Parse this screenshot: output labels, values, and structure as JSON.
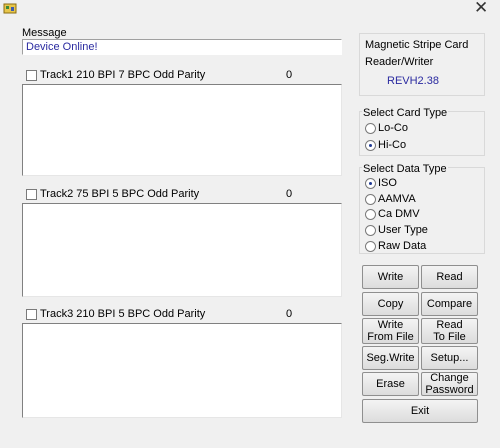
{
  "message": {
    "label": "Message",
    "value": "Device Online!"
  },
  "tracks": [
    {
      "label": "Track1  210 BPI  7 BPC  Odd Parity",
      "count": "0"
    },
    {
      "label": "Track2  75 BPI  5 BPC  Odd Parity",
      "count": "0"
    },
    {
      "label": "Track3  210 BPI  5 BPC  Odd Parity",
      "count": "0"
    }
  ],
  "device": {
    "line1": "Magnetic Stripe Card",
    "line2": "Reader/Writer",
    "version": "REVH2.38"
  },
  "card_type": {
    "title": "Select Card Type",
    "options": [
      "Lo-Co",
      "Hi-Co"
    ],
    "selected": "Hi-Co"
  },
  "data_type": {
    "title": "Select Data Type",
    "options": [
      "ISO",
      "AAMVA",
      "Ca DMV",
      "User Type",
      "Raw Data"
    ],
    "selected": "ISO"
  },
  "buttons": {
    "write": "Write",
    "read": "Read",
    "copy": "Copy",
    "compare": "Compare",
    "write_from_file": "Write\nFrom File",
    "read_to_file": "Read\nTo File",
    "seg_write": "Seg.Write",
    "setup": "Setup...",
    "erase": "Erase",
    "change_password": "Change\nPassword",
    "exit": "Exit"
  },
  "colors": {
    "version": "#2a2aa0",
    "message_text": "#2a2aa0",
    "radio_dot": "#1f3a93"
  }
}
